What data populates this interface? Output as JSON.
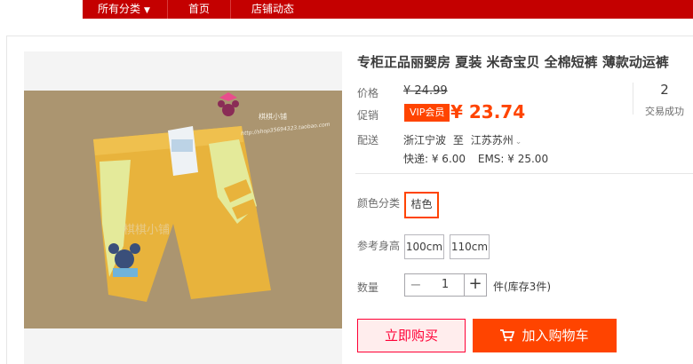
{
  "nav": {
    "all_categories": "所有分类",
    "home": "首页",
    "store_news": "店铺动态"
  },
  "product": {
    "title": "专柜正品丽婴房 夏装 米奇宝贝 全棉短裤 薄款动运裤",
    "watermark": "棋棋小铺",
    "watermark_url": "http://shop35694323.taobao.com"
  },
  "price": {
    "label": "价格",
    "original": "¥ 24.99",
    "promo_label": "促销",
    "vip_badge": "VIP会员",
    "promo": "¥ 23.74"
  },
  "sales": {
    "count": "2",
    "label": "交易成功"
  },
  "delivery": {
    "label": "配送",
    "from": "浙江宁波",
    "to_word": "至",
    "to": "江苏苏州",
    "express": "快递: ¥ 6.00",
    "ems": "EMS: ¥ 25.00"
  },
  "options": {
    "color_label": "颜色分类",
    "color_value": "桔色",
    "size_label": "参考身高",
    "sizes": [
      "100cm",
      "110cm"
    ]
  },
  "quantity": {
    "label": "数量",
    "value": "1",
    "stock": "件(库存3件)"
  },
  "actions": {
    "buy_now": "立即购买",
    "add_to_cart": "加入购物车"
  },
  "colors": {
    "brand_red": "#c40000",
    "accent_orange": "#ff4400",
    "buy_border": "#ff0036"
  }
}
